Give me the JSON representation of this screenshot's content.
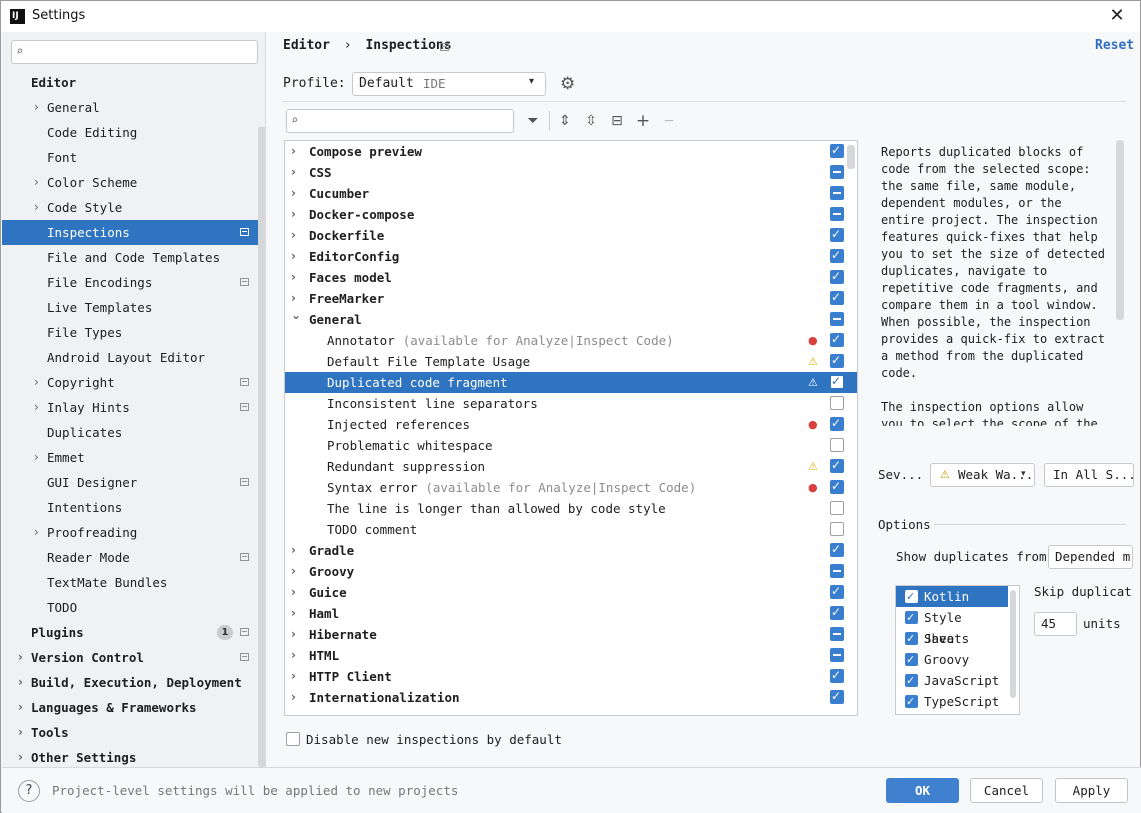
{
  "window": {
    "title": "Settings",
    "close_symbol": "✕"
  },
  "sidebar": {
    "search_placeholder": "",
    "items": [
      {
        "label": "Editor",
        "chevron": "",
        "bold": true
      },
      {
        "label": "General",
        "chevron": "›"
      },
      {
        "label": "Code Editing",
        "chevron": ""
      },
      {
        "label": "Font",
        "chevron": ""
      },
      {
        "label": "Color Scheme",
        "chevron": "›"
      },
      {
        "label": "Code Style",
        "chevron": "›"
      },
      {
        "label": "Inspections",
        "chevron": "",
        "selected": true,
        "mark": true
      },
      {
        "label": "File and Code Templates",
        "chevron": ""
      },
      {
        "label": "File Encodings",
        "chevron": "",
        "mark": true
      },
      {
        "label": "Live Templates",
        "chevron": ""
      },
      {
        "label": "File Types",
        "chevron": ""
      },
      {
        "label": "Android Layout Editor",
        "chevron": ""
      },
      {
        "label": "Copyright",
        "chevron": "›",
        "mark": true
      },
      {
        "label": "Inlay Hints",
        "chevron": "›",
        "mark": true
      },
      {
        "label": "Duplicates",
        "chevron": ""
      },
      {
        "label": "Emmet",
        "chevron": "›"
      },
      {
        "label": "GUI Designer",
        "chevron": "",
        "mark": true
      },
      {
        "label": "Intentions",
        "chevron": ""
      },
      {
        "label": "Proofreading",
        "chevron": "›"
      },
      {
        "label": "Reader Mode",
        "chevron": "",
        "mark": true
      },
      {
        "label": "TextMate Bundles",
        "chevron": ""
      },
      {
        "label": "TODO",
        "chevron": ""
      },
      {
        "label": "Plugins",
        "chevron": "",
        "bold": true,
        "badge": "1",
        "mark": true
      },
      {
        "label": "Version Control",
        "chevron": "›",
        "bold": true,
        "mark": true
      },
      {
        "label": "Build, Execution, Deployment",
        "chevron": "›",
        "bold": true
      },
      {
        "label": "Languages & Frameworks",
        "chevron": "›",
        "bold": true
      },
      {
        "label": "Tools",
        "chevron": "›",
        "bold": true
      },
      {
        "label": "Other Settings",
        "chevron": "›",
        "bold": true
      }
    ]
  },
  "header": {
    "breadcrumb": [
      "Editor",
      "›",
      "Inspections"
    ],
    "reset_label": "Reset",
    "profile_label": "Profile:",
    "profile_value": "Default",
    "profile_scope": "IDE",
    "profile_arrow": "▾"
  },
  "toolbar": {
    "search_placeholder": "",
    "filter_icon": "⏷",
    "expand_icon": "⇕",
    "collapse_icon": "⇳",
    "reset_icon": "⊟",
    "add_icon": "+",
    "remove_icon": "−"
  },
  "inspections": [
    {
      "label": "Compose preview",
      "group": true,
      "state": "on"
    },
    {
      "label": "CSS",
      "group": true,
      "state": "part"
    },
    {
      "label": "Cucumber",
      "group": true,
      "state": "part"
    },
    {
      "label": "Docker-compose",
      "group": true,
      "state": "part"
    },
    {
      "label": "Dockerfile",
      "group": true,
      "state": "on"
    },
    {
      "label": "EditorConfig",
      "group": true,
      "state": "on"
    },
    {
      "label": "Faces model",
      "group": true,
      "state": "on"
    },
    {
      "label": "FreeMarker",
      "group": true,
      "state": "on"
    },
    {
      "label": "General",
      "group": true,
      "expanded": true,
      "state": "part"
    },
    {
      "label": "Annotator",
      "hint": "(available for Analyze|Inspect Code)",
      "sev": "err",
      "state": "on"
    },
    {
      "label": "Default File Template Usage",
      "sev": "warn",
      "state": "on"
    },
    {
      "label": "Duplicated code fragment",
      "sev": "warn",
      "state": "on",
      "selected": true
    },
    {
      "label": "Inconsistent line separators",
      "state": "off"
    },
    {
      "label": "Injected references",
      "sev": "err",
      "state": "on"
    },
    {
      "label": "Problematic whitespace",
      "state": "off"
    },
    {
      "label": "Redundant suppression",
      "sev": "warn",
      "state": "on"
    },
    {
      "label": "Syntax error",
      "hint": "(available for Analyze|Inspect Code)",
      "sev": "err",
      "state": "on"
    },
    {
      "label": "The line is longer than allowed by code style",
      "state": "off"
    },
    {
      "label": "TODO comment",
      "state": "off"
    },
    {
      "label": "Gradle",
      "group": true,
      "state": "on"
    },
    {
      "label": "Groovy",
      "group": true,
      "state": "part"
    },
    {
      "label": "Guice",
      "group": true,
      "state": "on"
    },
    {
      "label": "Haml",
      "group": true,
      "state": "on"
    },
    {
      "label": "Hibernate",
      "group": true,
      "state": "part"
    },
    {
      "label": "HTML",
      "group": true,
      "state": "part"
    },
    {
      "label": "HTTP Client",
      "group": true,
      "state": "on"
    },
    {
      "label": "Internationalization",
      "group": true,
      "state": "on"
    }
  ],
  "disable_new_label": "Disable new inspections by default",
  "description": {
    "text": "Reports duplicated blocks of\ncode from the selected scope:\nthe same file, same module,\ndependent modules, or the\nentire project. The inspection\nfeatures quick-fixes that help\nyou to set the size of detected\nduplicates, navigate to\nrepetitive code fragments, and\ncompare them in a tool window.\nWhen possible, the inspection\nprovides a quick-fix to extract\na method from the duplicated\ncode.\n\nThe inspection options allow\nyou to select the scope of the"
  },
  "severity": {
    "label": "Sev...",
    "value": "Weak Wa...",
    "scope": "In All S...",
    "warn_icon": "⚠",
    "arrow": "▾"
  },
  "options": {
    "label": "Options",
    "show_dup_label": "Show duplicates from:",
    "show_dup_value": "Depended m",
    "languages": [
      {
        "label": "Kotlin",
        "selected": true
      },
      {
        "label": "Style Sheets"
      },
      {
        "label": "Java"
      },
      {
        "label": "Groovy"
      },
      {
        "label": "JavaScript"
      },
      {
        "label": "TypeScript"
      }
    ],
    "skip_label": "Skip duplicat",
    "skip_value": "45",
    "units_label": "units"
  },
  "footer": {
    "help": "?",
    "note": "Project-level settings will be applied to new projects",
    "ok": "OK",
    "cancel": "Cancel",
    "apply": "Apply"
  },
  "colors": {
    "accent": "#2f74c0",
    "error": "#d9413d",
    "warning": "#e0b100",
    "link": "#2f6fc1"
  }
}
